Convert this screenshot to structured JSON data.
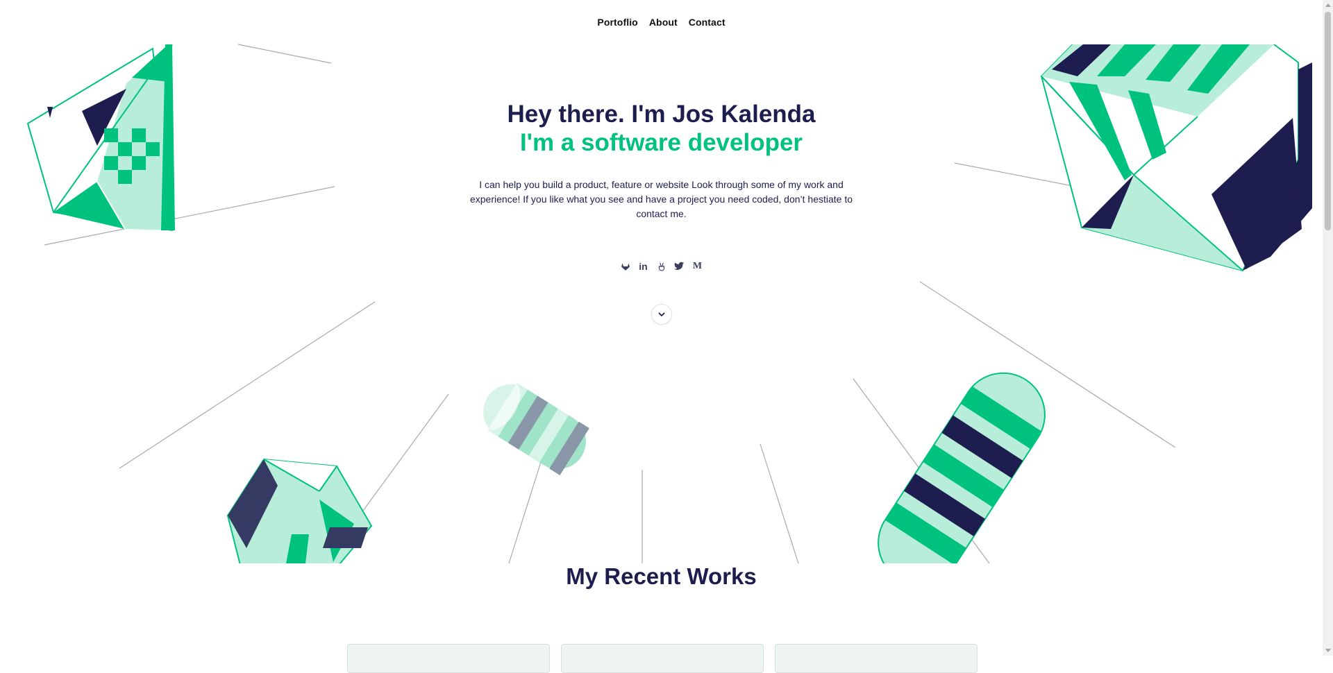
{
  "nav": {
    "items": [
      {
        "label": "Portoflio"
      },
      {
        "label": "About"
      },
      {
        "label": "Contact"
      }
    ]
  },
  "hero": {
    "title": "Hey there. I'm Jos Kalenda",
    "subtitle": "I'm a software developer",
    "description": "I can help you build a product, feature or website Look through some of my work and experience! If you like what you see and have a project you need coded, don’t hestiate to contact me."
  },
  "social": {
    "icons": [
      "gitlab-icon",
      "linkedin-icon",
      "angellist-icon",
      "twitter-icon",
      "medium-icon"
    ],
    "linkedin_glyph": "in",
    "medium_glyph": "M"
  },
  "scroll_down": {
    "icon": "chevron-down-icon"
  },
  "works": {
    "title": "My Recent Works"
  },
  "colors": {
    "navy": "#1e1d4f",
    "green": "#00c27f",
    "mint": "#b8eed9",
    "line": "#a8a8b4"
  }
}
